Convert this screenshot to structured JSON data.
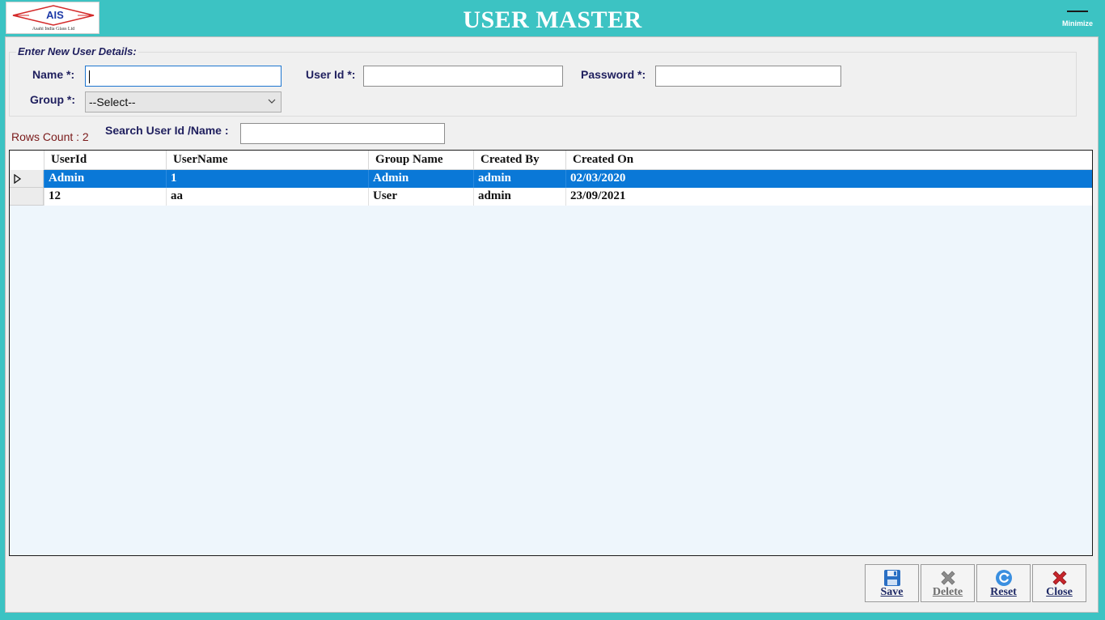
{
  "header": {
    "logo_text": "AIS",
    "logo_subtext": "Asahi India Glass Ltd",
    "title": "USER MASTER",
    "minimize_label": "Minimize"
  },
  "form": {
    "section_title": "Enter New User Details:",
    "name_label": "Name *:",
    "name_value": "",
    "userid_label": "User Id *:",
    "userid_value": "",
    "password_label": "Password *:",
    "password_value": "",
    "group_label": "Group *:",
    "group_selected": "--Select--"
  },
  "rows_count": "Rows Count : 2",
  "search": {
    "label": "Search User Id /Name :",
    "value": ""
  },
  "grid": {
    "columns": [
      "UserId",
      "UserName",
      "Group Name",
      "Created By",
      "Created On"
    ],
    "rows": [
      [
        "Admin",
        "1",
        "Admin",
        "admin",
        "02/03/2020"
      ],
      [
        "12",
        "aa",
        "User",
        "admin",
        "23/09/2021"
      ]
    ]
  },
  "buttons": {
    "save": "Save",
    "delete": "Delete",
    "reset": "Reset",
    "close": "Close"
  },
  "colors": {
    "frame": "#3cc3c3",
    "selection": "#0a78d7",
    "label": "#1f1f5e"
  }
}
